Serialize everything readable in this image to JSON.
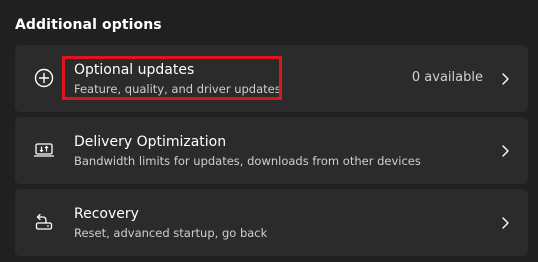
{
  "section": {
    "title": "Additional options"
  },
  "items": [
    {
      "id": "optional-updates",
      "title": "Optional updates",
      "subtitle": "Feature, quality, and driver updates",
      "value": "0 available",
      "icon": "plus-circle-icon"
    },
    {
      "id": "delivery-optimization",
      "title": "Delivery Optimization",
      "subtitle": "Bandwidth limits for updates, downloads from other devices",
      "value": "",
      "icon": "delivery-optimization-icon"
    },
    {
      "id": "recovery",
      "title": "Recovery",
      "subtitle": "Reset, advanced startup, go back",
      "value": "",
      "icon": "recovery-icon"
    }
  ],
  "colors": {
    "background": "#202020",
    "card": "#2b2b2b",
    "highlight": "#e0141e"
  }
}
